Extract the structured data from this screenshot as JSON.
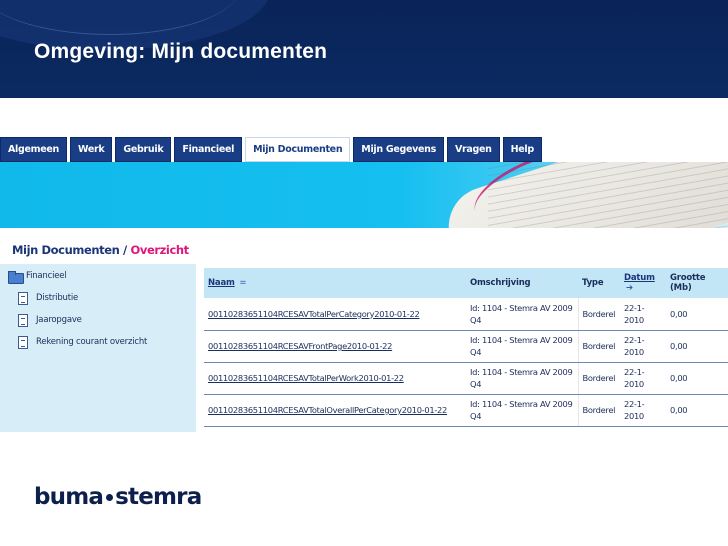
{
  "slide": {
    "title": "Omgeving: Mijn documenten"
  },
  "tabs": [
    {
      "label": "Algemeen",
      "active": false
    },
    {
      "label": "Werk",
      "active": false
    },
    {
      "label": "Gebruik",
      "active": false
    },
    {
      "label": "Financieel",
      "active": false
    },
    {
      "label": "Mijn Documenten",
      "active": true
    },
    {
      "label": "Mijn Gegevens",
      "active": false
    },
    {
      "label": "Vragen",
      "active": false
    },
    {
      "label": "Help",
      "active": false
    }
  ],
  "breadcrumb": {
    "parent": "Mijn Documenten",
    "separator": "/",
    "current": "Overzicht"
  },
  "sidebar": {
    "root": {
      "label": "Financieel",
      "icon": "folder-open-icon"
    },
    "items": [
      {
        "label": "Distributie",
        "icon": "document-icon"
      },
      {
        "label": "Jaaropgave",
        "icon": "document-icon"
      },
      {
        "label": "Rekening courant overzicht",
        "icon": "document-icon"
      }
    ]
  },
  "table": {
    "headers": {
      "naam": "Naam",
      "naam_sort": "=",
      "omschrijving": "Omschrijving",
      "type": "Type",
      "datum": "Datum",
      "datum_sort": "➔",
      "grootte": "Grootte (Mb)"
    },
    "rows": [
      {
        "naam": "00110283651104RCESAVTotalPerCategory2010-01-22",
        "omschrijving": "Id: 1104 - Stemra AV 2009 Q4",
        "type": "Borderel",
        "datum": "22-1-2010",
        "grootte": "0,00"
      },
      {
        "naam": "00110283651104RCESAVFrontPage2010-01-22",
        "omschrijving": "Id: 1104 - Stemra AV 2009 Q4",
        "type": "Borderel",
        "datum": "22-1-2010",
        "grootte": "0,00"
      },
      {
        "naam": "00110283651104RCESAVTotalPerWork2010-01-22",
        "omschrijving": "Id: 1104 - Stemra AV 2009 Q4",
        "type": "Borderel",
        "datum": "22-1-2010",
        "grootte": "0,00"
      },
      {
        "naam": "00110283651104RCESAVTotalOverallPerCategory2010-01-22",
        "omschrijving": "Id: 1104 - Stemra AV 2009 Q4",
        "type": "Borderel",
        "datum": "22-1-2010",
        "grootte": "0,00"
      }
    ]
  },
  "logo": {
    "left": "buma",
    "right": "stemra"
  },
  "colors": {
    "header_bg": "#0a2457",
    "tab_bg": "#1a3e86",
    "accent_pink": "#e0157a",
    "banner_cyan": "#10b9ea",
    "sidebar_bg": "#d7edf8",
    "table_header_bg": "#c3e6f7"
  }
}
